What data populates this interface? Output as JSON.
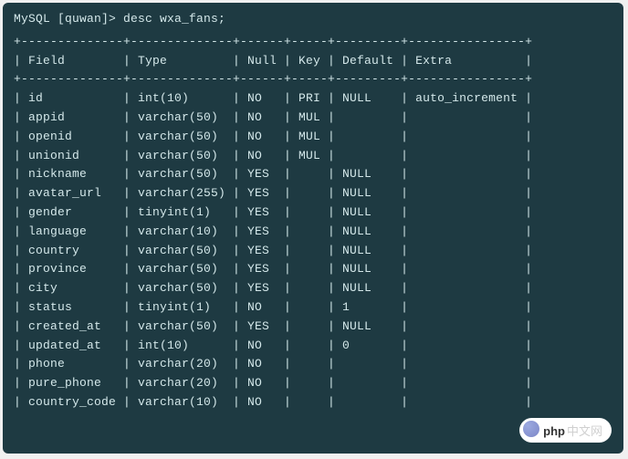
{
  "prompt": "MySQL [quwan]> desc wxa_fans;",
  "separator_top": "+--------------+--------------+------+-----+---------+----------------+",
  "header": {
    "field": "Field",
    "type": "Type",
    "null": "Null",
    "key": "Key",
    "default": "Default",
    "extra": "Extra"
  },
  "rows": [
    {
      "field": "id",
      "type": "int(10)",
      "null": "NO",
      "key": "PRI",
      "default": "NULL",
      "extra": "auto_increment"
    },
    {
      "field": "appid",
      "type": "varchar(50)",
      "null": "NO",
      "key": "MUL",
      "default": "",
      "extra": ""
    },
    {
      "field": "openid",
      "type": "varchar(50)",
      "null": "NO",
      "key": "MUL",
      "default": "",
      "extra": ""
    },
    {
      "field": "unionid",
      "type": "varchar(50)",
      "null": "NO",
      "key": "MUL",
      "default": "",
      "extra": ""
    },
    {
      "field": "nickname",
      "type": "varchar(50)",
      "null": "YES",
      "key": "",
      "default": "NULL",
      "extra": ""
    },
    {
      "field": "avatar_url",
      "type": "varchar(255)",
      "null": "YES",
      "key": "",
      "default": "NULL",
      "extra": ""
    },
    {
      "field": "gender",
      "type": "tinyint(1)",
      "null": "YES",
      "key": "",
      "default": "NULL",
      "extra": ""
    },
    {
      "field": "language",
      "type": "varchar(10)",
      "null": "YES",
      "key": "",
      "default": "NULL",
      "extra": ""
    },
    {
      "field": "country",
      "type": "varchar(50)",
      "null": "YES",
      "key": "",
      "default": "NULL",
      "extra": ""
    },
    {
      "field": "province",
      "type": "varchar(50)",
      "null": "YES",
      "key": "",
      "default": "NULL",
      "extra": ""
    },
    {
      "field": "city",
      "type": "varchar(50)",
      "null": "YES",
      "key": "",
      "default": "NULL",
      "extra": ""
    },
    {
      "field": "status",
      "type": "tinyint(1)",
      "null": "NO",
      "key": "",
      "default": "1",
      "extra": ""
    },
    {
      "field": "created_at",
      "type": "varchar(50)",
      "null": "YES",
      "key": "",
      "default": "NULL",
      "extra": ""
    },
    {
      "field": "updated_at",
      "type": "int(10)",
      "null": "NO",
      "key": "",
      "default": "0",
      "extra": ""
    },
    {
      "field": "phone",
      "type": "varchar(20)",
      "null": "NO",
      "key": "",
      "default": "",
      "extra": ""
    },
    {
      "field": "pure_phone",
      "type": "varchar(20)",
      "null": "NO",
      "key": "",
      "default": "",
      "extra": ""
    },
    {
      "field": "country_code",
      "type": "varchar(10)",
      "null": "NO",
      "key": "",
      "default": "",
      "extra": ""
    }
  ],
  "logo": {
    "text": "php",
    "cn": "中文网"
  }
}
